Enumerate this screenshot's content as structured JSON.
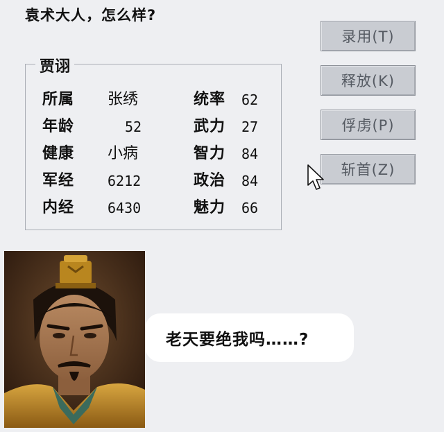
{
  "prompt": "袁术大人，怎么样?",
  "officer": {
    "name": "贾诩",
    "rows": [
      {
        "label": "所属",
        "value": "张绣",
        "stat_label": "统率",
        "stat_value": "62"
      },
      {
        "label": "年龄",
        "value": "52",
        "stat_label": "武力",
        "stat_value": "27"
      },
      {
        "label": "健康",
        "value": "小病",
        "stat_label": "智力",
        "stat_value": "84"
      },
      {
        "label": "军经",
        "value": "6212",
        "stat_label": "政治",
        "stat_value": "84"
      },
      {
        "label": "内经",
        "value": "6430",
        "stat_label": "魅力",
        "stat_value": "66"
      }
    ]
  },
  "buttons": {
    "recruit": "录用(T)",
    "release": "释放(K)",
    "capture": "俘虏(P)",
    "execute": "斩首(Z)"
  },
  "dialogue": "老天要绝我吗……?",
  "icons": {
    "cursor": "arrow-cursor-icon"
  },
  "colors": {
    "background": "#eeeff2",
    "button_face": "#c9ccd2",
    "button_text": "#555a62"
  }
}
